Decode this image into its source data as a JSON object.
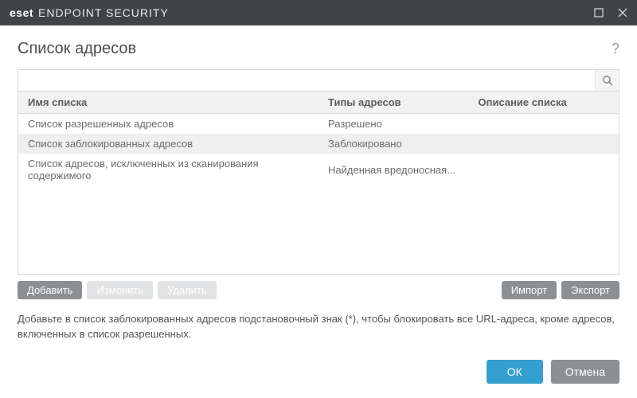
{
  "titlebar": {
    "brand_bold": "eset",
    "brand_light": "ENDPOINT SECURITY"
  },
  "page": {
    "title": "Список адресов",
    "help_symbol": "?"
  },
  "search": {
    "placeholder": ""
  },
  "table": {
    "headers": {
      "name": "Имя списка",
      "type": "Типы адресов",
      "desc": "Описание списка"
    },
    "rows": [
      {
        "name": "Список разрешенных адресов",
        "type": "Разрешено",
        "desc": "",
        "selected": false
      },
      {
        "name": "Список заблокированных адресов",
        "type": "Заблокировано",
        "desc": "",
        "selected": true
      },
      {
        "name": "Список адресов, исключенных из сканирования содержимого",
        "type": "Найденная вредоносная...",
        "desc": "",
        "selected": false
      }
    ]
  },
  "toolbar": {
    "add": "Добавить",
    "edit": "Изменить",
    "delete": "Удалить",
    "import": "Импорт",
    "export": "Экспорт"
  },
  "hint": "Добавьте в список заблокированных адресов подстановочный знак (*), чтобы блокировать все URL-адреса, кроме адресов, включенных в список разрешенных.",
  "footer": {
    "ok": "ОК",
    "cancel": "Отмена"
  }
}
